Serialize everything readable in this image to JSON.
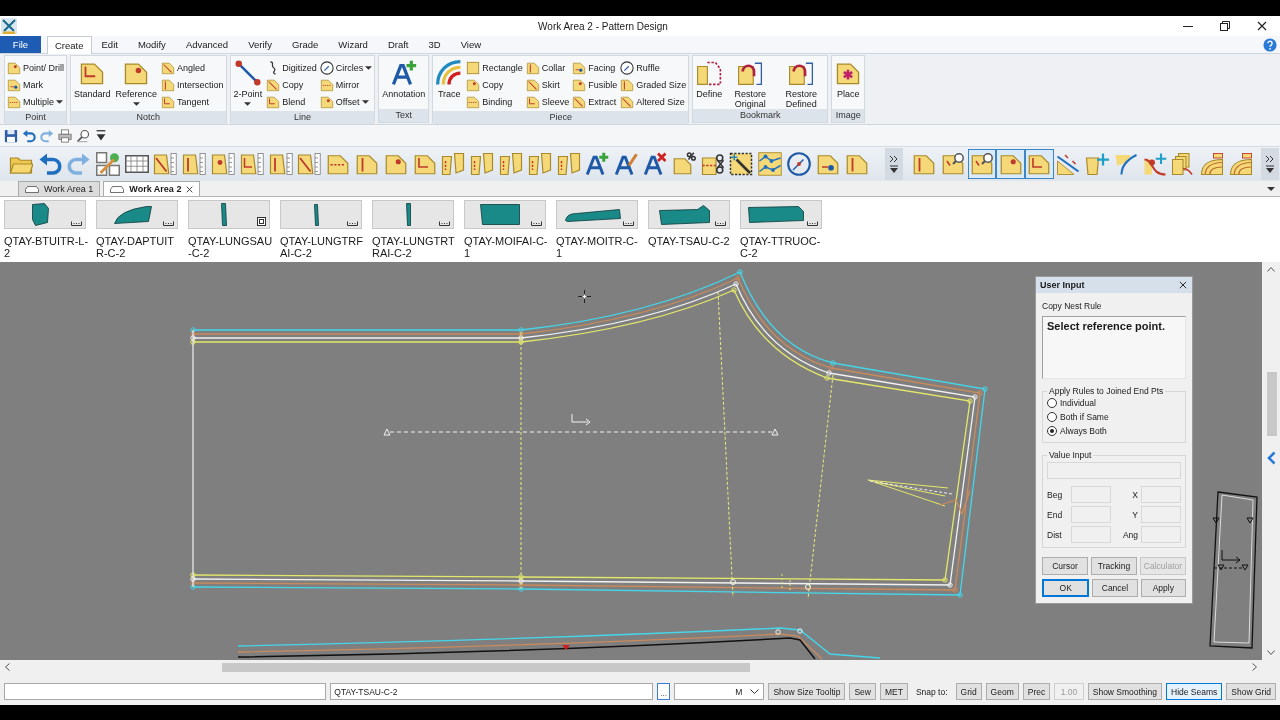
{
  "window": {
    "title": "Work Area 2 - Pattern Design"
  },
  "menu_tabs": [
    {
      "label": "File",
      "kind": "app",
      "selected": false
    },
    {
      "label": "Create",
      "kind": "tab",
      "selected": true
    },
    {
      "label": "Edit",
      "kind": "tab",
      "selected": false
    },
    {
      "label": "Modify",
      "kind": "tab",
      "selected": false
    },
    {
      "label": "Advanced",
      "kind": "tab",
      "selected": false
    },
    {
      "label": "Verify",
      "kind": "tab",
      "selected": false
    },
    {
      "label": "Grade",
      "kind": "tab",
      "selected": false
    },
    {
      "label": "Wizard",
      "kind": "tab",
      "selected": false
    },
    {
      "label": "Draft",
      "kind": "tab",
      "selected": false
    },
    {
      "label": "3D",
      "kind": "tab",
      "selected": false
    },
    {
      "label": "View",
      "kind": "tab",
      "selected": false
    }
  ],
  "ribbon": [
    {
      "title": "Point",
      "items": [
        {
          "label": "Point/ Drill",
          "kind": "small",
          "dropdown": false
        },
        {
          "label": "Mark",
          "kind": "small",
          "dropdown": false
        },
        {
          "label": "Multiple",
          "kind": "small",
          "dropdown": true
        }
      ]
    },
    {
      "title": "Notch",
      "items": [
        {
          "label": "Standard",
          "kind": "large",
          "dropdown": false
        },
        {
          "label": "Reference",
          "kind": "large",
          "dropdown": true
        },
        {
          "label": "Angled",
          "kind": "small",
          "dropdown": false
        },
        {
          "label": "Intersection",
          "kind": "small",
          "dropdown": false
        },
        {
          "label": "Tangent",
          "kind": "small",
          "dropdown": false
        }
      ]
    },
    {
      "title": "Line",
      "items": [
        {
          "label": "2-Point",
          "kind": "large",
          "dropdown": true
        },
        {
          "label": "Digitized",
          "kind": "small",
          "dropdown": false
        },
        {
          "label": "Copy",
          "kind": "small",
          "dropdown": false
        },
        {
          "label": "Blend",
          "kind": "small",
          "dropdown": false
        },
        {
          "label": "Circles",
          "kind": "small",
          "dropdown": true
        },
        {
          "label": "Mirror",
          "kind": "small",
          "dropdown": false
        },
        {
          "label": "Offset",
          "kind": "small",
          "dropdown": true
        }
      ]
    },
    {
      "title": "Text",
      "items": [
        {
          "label": "Annotation",
          "kind": "large",
          "dropdown": false
        }
      ]
    },
    {
      "title": "Piece",
      "items": [
        {
          "label": "Trace",
          "kind": "large",
          "dropdown": false
        },
        {
          "label": "Rectangle",
          "kind": "small",
          "dropdown": false
        },
        {
          "label": "Copy",
          "kind": "small",
          "dropdown": false
        },
        {
          "label": "Binding",
          "kind": "small",
          "dropdown": false
        },
        {
          "label": "Collar",
          "kind": "small",
          "dropdown": false
        },
        {
          "label": "Skirt",
          "kind": "small",
          "dropdown": false
        },
        {
          "label": "Sleeve",
          "kind": "small",
          "dropdown": false
        },
        {
          "label": "Facing",
          "kind": "small",
          "dropdown": false
        },
        {
          "label": "Fusible",
          "kind": "small",
          "dropdown": false
        },
        {
          "label": "Extract",
          "kind": "small",
          "dropdown": false
        },
        {
          "label": "Ruffle",
          "kind": "small",
          "dropdown": false
        },
        {
          "label": "Graded Size",
          "kind": "small",
          "dropdown": false
        },
        {
          "label": "Altered Size",
          "kind": "small",
          "dropdown": false
        }
      ]
    },
    {
      "title": "Bookmark",
      "items": [
        {
          "label": "Define",
          "kind": "large",
          "dropdown": false
        },
        {
          "label": "Restore Original",
          "kind": "large",
          "dropdown": false
        },
        {
          "label": "Restore Defined",
          "kind": "large",
          "dropdown": false
        }
      ]
    },
    {
      "title": "Image",
      "items": [
        {
          "label": "Place",
          "kind": "large",
          "dropdown": false
        }
      ]
    }
  ],
  "toolbar": [
    {
      "buttons": [
        {
          "selected": false
        },
        {
          "selected": false
        },
        {
          "selected": false
        },
        {
          "selected": false
        },
        {
          "selected": false
        },
        {
          "selected": false
        },
        {
          "selected": false
        },
        {
          "selected": false
        },
        {
          "selected": false
        },
        {
          "selected": false
        },
        {
          "selected": false
        },
        {
          "selected": false
        },
        {
          "selected": false
        },
        {
          "selected": false
        },
        {
          "selected": false
        },
        {
          "selected": false
        },
        {
          "selected": false
        },
        {
          "selected": false
        },
        {
          "selected": false
        },
        {
          "selected": false
        },
        {
          "selected": false
        },
        {
          "selected": false
        },
        {
          "selected": false
        },
        {
          "selected": false
        },
        {
          "selected": false
        },
        {
          "selected": false
        },
        {
          "selected": false
        },
        {
          "selected": false
        },
        {
          "selected": false
        },
        {
          "selected": false
        }
      ]
    },
    {
      "buttons": [
        {
          "selected": false
        },
        {
          "selected": false
        },
        {
          "selected": true
        },
        {
          "selected": true
        },
        {
          "selected": true
        },
        {
          "selected": false
        },
        {
          "selected": false
        },
        {
          "selected": false
        },
        {
          "selected": false
        },
        {
          "selected": false
        },
        {
          "selected": false
        },
        {
          "selected": false
        }
      ]
    }
  ],
  "work_area_tabs": [
    {
      "label": "Work Area 1",
      "selected": false
    },
    {
      "label": "Work Area 2",
      "selected": true
    }
  ],
  "pieces": [
    {
      "name": "QTAY-BTUITR-L-2",
      "kind": "bracket"
    },
    {
      "name": "QTAY-DAPTUITR-C-2",
      "kind": "bracket"
    },
    {
      "name": "QTAY-LUNGSAU-C-2",
      "kind": "square"
    },
    {
      "name": "QTAY-LUNGTRFAI-C-2",
      "kind": "bracket"
    },
    {
      "name": "QTAY-LUNGTRTRAI-C-2",
      "kind": "bracket"
    },
    {
      "name": "QTAY-MOIFAI-C-1",
      "kind": "bracket"
    },
    {
      "name": "QTAY-MOITR-C-1",
      "kind": "bracket"
    },
    {
      "name": "QTAY-TSAU-C-2",
      "kind": "bracket"
    },
    {
      "name": "QTAY-TTRUOC-C-2",
      "kind": "bracket"
    }
  ],
  "user_input": {
    "title": "User Input",
    "rule": "Copy Nest Rule",
    "prompt": "Select reference point.",
    "joined_ends": {
      "title": "Apply Rules to Joined End Pts",
      "options": [
        {
          "label": "Individual",
          "selected": false
        },
        {
          "label": "Both if Same",
          "selected": false
        },
        {
          "label": "Always Both",
          "selected": true
        }
      ]
    },
    "value_input": {
      "title": "Value Input",
      "fields": [
        {
          "label": "Beg"
        },
        {
          "label": "X"
        },
        {
          "label": "End"
        },
        {
          "label": "Y"
        },
        {
          "label": "Dist"
        },
        {
          "label": "Ang"
        }
      ]
    },
    "tool_buttons": [
      {
        "label": "Cursor",
        "disabled": false
      },
      {
        "label": "Tracking",
        "disabled": false
      },
      {
        "label": "Calculator",
        "disabled": true
      }
    ],
    "action_buttons": [
      {
        "label": "OK",
        "focused": true
      },
      {
        "label": "Cancel",
        "focused": false
      },
      {
        "label": "Apply",
        "focused": false
      }
    ]
  },
  "status_bar": {
    "piece_field": "QTAY-TSAU-C-2",
    "browse_button": "...",
    "unit_dropdown": "M",
    "toggles": [
      {
        "label": "Show Size Tooltip",
        "selected": false
      },
      {
        "label": "Sew",
        "selected": false
      },
      {
        "label": "MET",
        "selected": false
      }
    ],
    "snap_label": "Snap to:",
    "snap_toggles": [
      {
        "label": "Grid",
        "selected": false
      },
      {
        "label": "Geom",
        "selected": false
      },
      {
        "label": "Prec",
        "selected": false
      }
    ],
    "precision_field": {
      "value": "1.00",
      "disabled": true
    },
    "view_toggles": [
      {
        "label": "Show Smoothing",
        "selected": false
      },
      {
        "label": "Hide Seams",
        "selected": true
      },
      {
        "label": "Show Grid",
        "selected": false
      }
    ]
  }
}
